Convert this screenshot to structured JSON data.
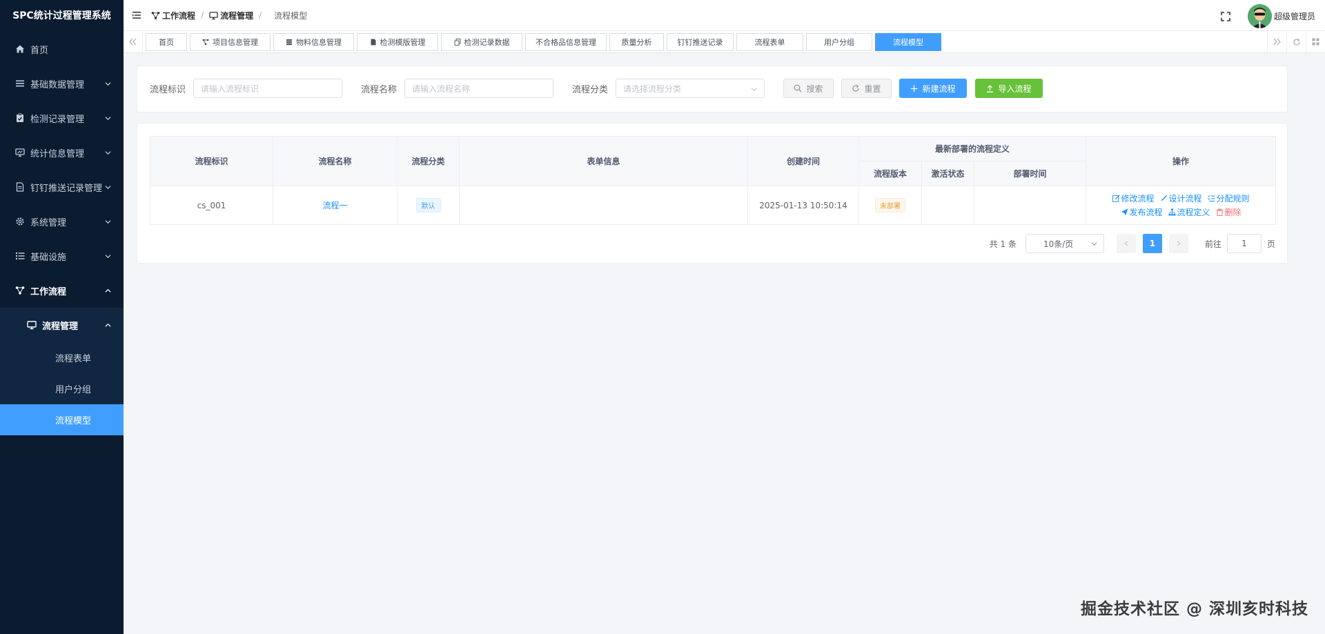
{
  "app": {
    "title": "SPC统计过程管理系统"
  },
  "sidebar": {
    "items": [
      {
        "label": "首页"
      },
      {
        "label": "基础数据管理"
      },
      {
        "label": "检测记录管理"
      },
      {
        "label": "统计信息管理"
      },
      {
        "label": "钉钉推送记录管理"
      },
      {
        "label": "系统管理"
      },
      {
        "label": "基础设施"
      },
      {
        "label": "工作流程"
      }
    ],
    "submenu": {
      "label": "流程管理"
    },
    "leaves": [
      {
        "label": "流程表单"
      },
      {
        "label": "用户分组"
      },
      {
        "label": "流程模型"
      }
    ]
  },
  "breadcrumb": {
    "level1": "工作流程",
    "level2": "流程管理",
    "current": "流程模型"
  },
  "user": {
    "name": "超级管理员"
  },
  "tabs": [
    {
      "label": "首页"
    },
    {
      "label": "项目信息管理"
    },
    {
      "label": "物料信息管理"
    },
    {
      "label": "检测模版管理"
    },
    {
      "label": "检测记录数据"
    },
    {
      "label": "不合格品信息管理"
    },
    {
      "label": "质量分析"
    },
    {
      "label": "钉钉推送记录"
    },
    {
      "label": "流程表单"
    },
    {
      "label": "用户分组"
    },
    {
      "label": "流程模型"
    }
  ],
  "search": {
    "key_label": "流程标识",
    "key_placeholder": "请输入流程标识",
    "name_label": "流程名称",
    "name_placeholder": "请输入流程名称",
    "category_label": "流程分类",
    "category_placeholder": "请选择流程分类",
    "search_button": "搜索",
    "reset_button": "重置",
    "new_button": "新建流程",
    "import_button": "导入流程"
  },
  "table": {
    "headers": {
      "key": "流程标识",
      "name": "流程名称",
      "category": "流程分类",
      "form": "表单信息",
      "created": "创建时间",
      "group": "最新部署的流程定义",
      "version": "流程版本",
      "active": "激活状态",
      "deploy_time": "部署时间",
      "ops": "操作"
    },
    "rows": [
      {
        "key": "cs_001",
        "name": "流程一",
        "category": "默认",
        "form": "",
        "created": "2025-01-13 10:50:14",
        "version": "未部署",
        "active": "",
        "deploy_time": ""
      }
    ],
    "ops": {
      "edit": "修改流程",
      "design": "设计流程",
      "assign": "分配规则",
      "publish": "发布流程",
      "define": "流程定义",
      "delete": "删除"
    }
  },
  "pagination": {
    "total": "共 1 条",
    "page_size": "10条/页",
    "current": "1",
    "goto": "前往",
    "goto_value": "1",
    "page_unit": "页"
  },
  "watermark": "掘金技术社区 @ 深圳亥时科技",
  "colors": {
    "sidebar_bg": "#0b1b30",
    "accent": "#409eff",
    "success": "#67c23a",
    "danger": "#f56c6c",
    "warning": "#e6a23c"
  }
}
